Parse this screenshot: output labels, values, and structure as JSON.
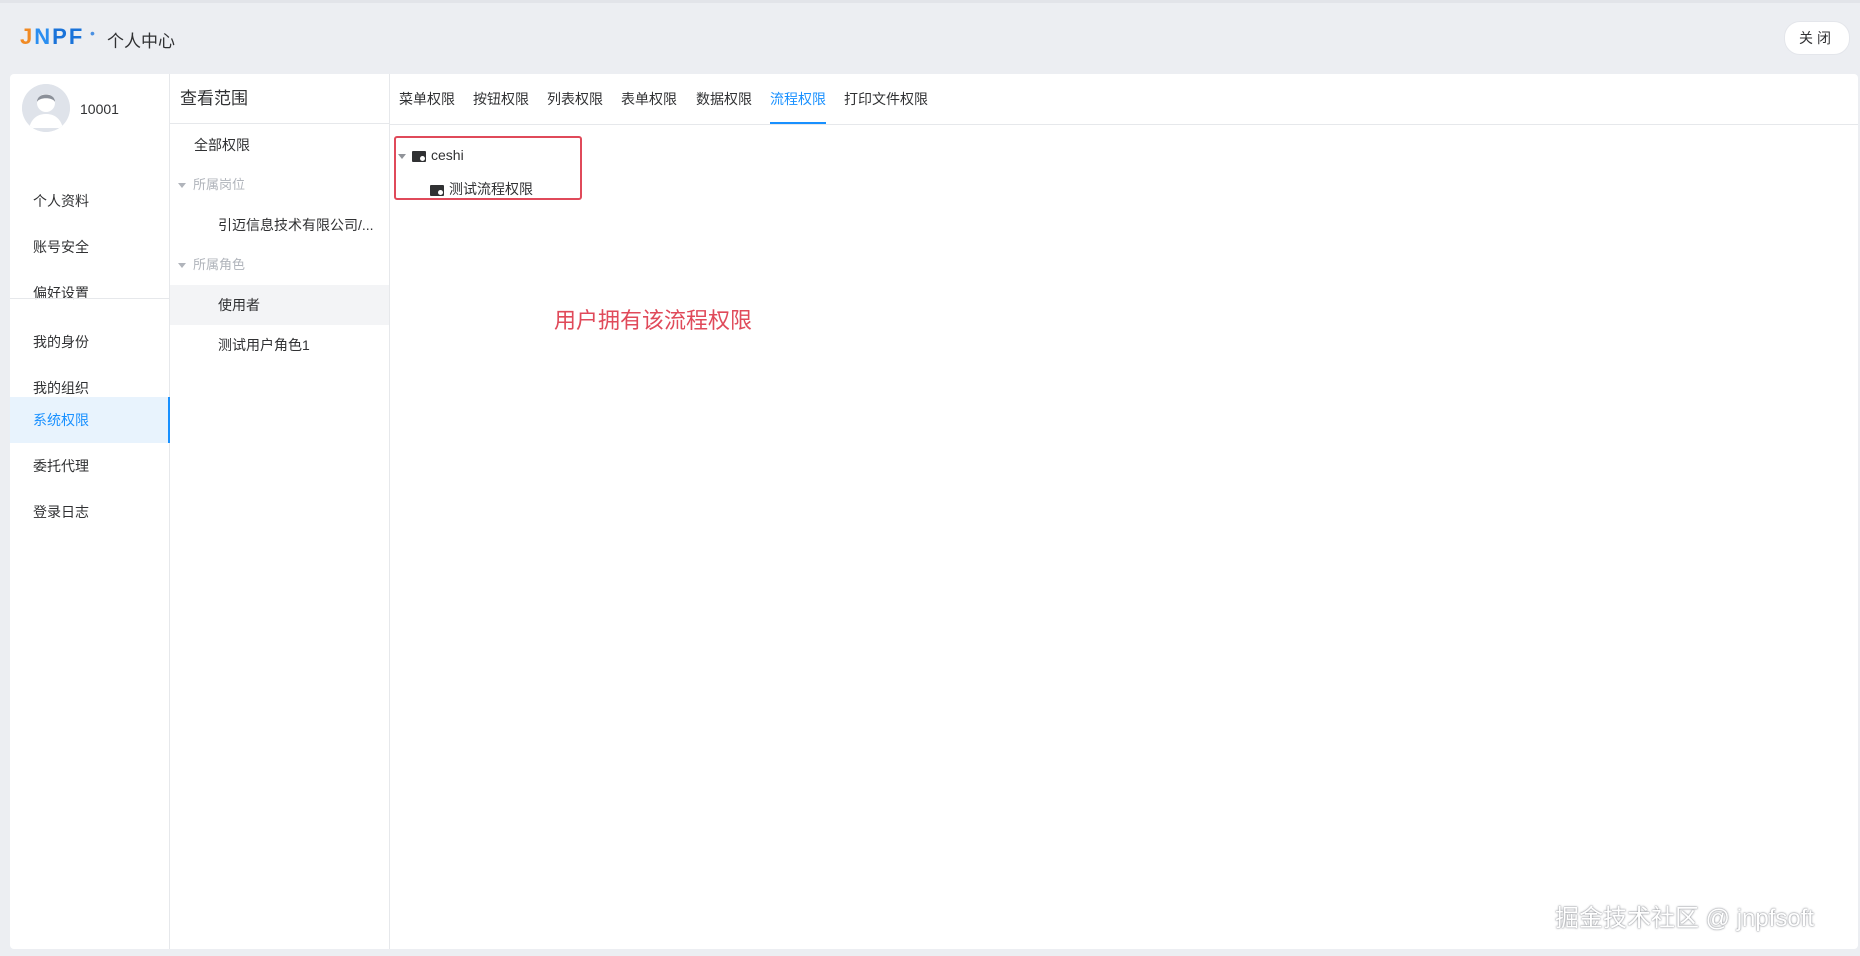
{
  "header": {
    "logo": {
      "j": "J",
      "n": "N",
      "pf": "PF"
    },
    "title": "个人中心",
    "close_label": "关闭"
  },
  "user": {
    "id": "10001"
  },
  "left_menu": {
    "items": [
      {
        "label": "个人资料"
      },
      {
        "label": "账号安全"
      },
      {
        "label": "偏好设置"
      },
      {
        "label": "我的身份"
      },
      {
        "label": "我的组织"
      },
      {
        "label": "系统权限",
        "active": true
      },
      {
        "label": "委托代理"
      },
      {
        "label": "登录日志"
      }
    ]
  },
  "scope": {
    "title": "查看范围",
    "all": "全部权限",
    "group_position": "所属岗位",
    "position_item": "引迈信息技术有限公司/...",
    "group_role": "所属角色",
    "role_items": [
      "使用者",
      "测试用户角色1"
    ]
  },
  "tabs": [
    {
      "label": "菜单权限"
    },
    {
      "label": "按钮权限"
    },
    {
      "label": "列表权限"
    },
    {
      "label": "表单权限"
    },
    {
      "label": "数据权限"
    },
    {
      "label": "流程权限",
      "active": true
    },
    {
      "label": "打印文件权限"
    }
  ],
  "tree": {
    "root": "ceshi",
    "child": "测试流程权限"
  },
  "annotation": "用户拥有该流程权限",
  "watermark": "掘金技术社区 @ jnpfsoft",
  "colors": {
    "accent": "#1890ff",
    "annotation": "#e04a5a",
    "logo_orange": "#f08a24",
    "logo_blue": "#1a73d9"
  }
}
